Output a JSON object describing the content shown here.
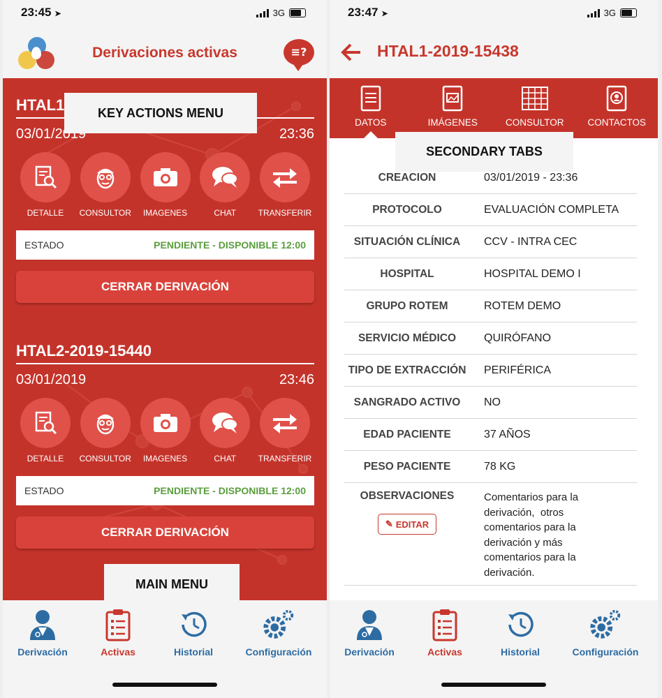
{
  "left": {
    "status": {
      "time": "23:45",
      "network": "3G"
    },
    "header": {
      "title": "Derivaciones activas"
    },
    "cards": [
      {
        "code": "HTAL1",
        "date": "03/01/2019",
        "time": "23:36",
        "actions": [
          "DETALLE",
          "CONSULTOR",
          "IMAGENES",
          "CHAT",
          "TRANSFERIR"
        ],
        "estado_label": "ESTADO",
        "estado_value": "PENDIENTE - DISPONIBLE 12:00",
        "close_label": "CERRAR DERIVACIÓN"
      },
      {
        "code": "HTAL2-2019-15440",
        "date": "03/01/2019",
        "time": "23:46",
        "actions": [
          "DETALLE",
          "CONSULTOR",
          "IMAGENES",
          "CHAT",
          "TRANSFERIR"
        ],
        "estado_label": "ESTADO",
        "estado_value": "PENDIENTE - DISPONIBLE 12:00",
        "close_label": "CERRAR DERIVACIÓN"
      }
    ],
    "callouts": {
      "key_actions": "KEY ACTIONS MENU",
      "main_menu": "MAIN MENU"
    },
    "nav": [
      "Derivación",
      "Activas",
      "Historial",
      "Configuración"
    ]
  },
  "right": {
    "status": {
      "time": "23:47",
      "network": "3G"
    },
    "header": {
      "title": "HTAL1-2019-15438"
    },
    "tabs": [
      "DATOS",
      "IMÁGENES",
      "CONSULTOR",
      "CONTACTOS"
    ],
    "callout": "SECONDARY TABS",
    "rows": [
      {
        "label": "CREACION",
        "value": "03/01/2019 - 23:36"
      },
      {
        "label": "PROTOCOLO",
        "value": "EVALUACIÓN COMPLETA"
      },
      {
        "label": "SITUACIÓN CLÍNICA",
        "value": "CCV - INTRA CEC"
      },
      {
        "label": "HOSPITAL",
        "value": "HOSPITAL DEMO I"
      },
      {
        "label": "GRUPO ROTEM",
        "value": "ROTEM DEMO"
      },
      {
        "label": "SERVICIO MÉDICO",
        "value": "QUIRÓFANO"
      },
      {
        "label": "TIPO DE EXTRACCIÓN",
        "value": "PERIFÉRICA"
      },
      {
        "label": "SANGRADO ACTIVO",
        "value": "NO"
      },
      {
        "label": "EDAD PACIENTE",
        "value": "37 AÑOS"
      },
      {
        "label": "PESO PACIENTE",
        "value": "78 KG"
      }
    ],
    "observaciones": {
      "label": "OBSERVACIONES",
      "edit_label": "EDITAR",
      "lines": [
        "Comentarios para la",
        "derivación,  otros",
        "comentarios para la",
        "derivación y más",
        "comentarios para la",
        "derivación."
      ]
    },
    "nav": [
      "Derivación",
      "Activas",
      "Historial",
      "Configuración"
    ]
  },
  "colors": {
    "brand_red": "#c8372d",
    "panel_red": "#c4332a",
    "status_green": "#5a9e3c",
    "nav_blue": "#2d6ca3"
  }
}
